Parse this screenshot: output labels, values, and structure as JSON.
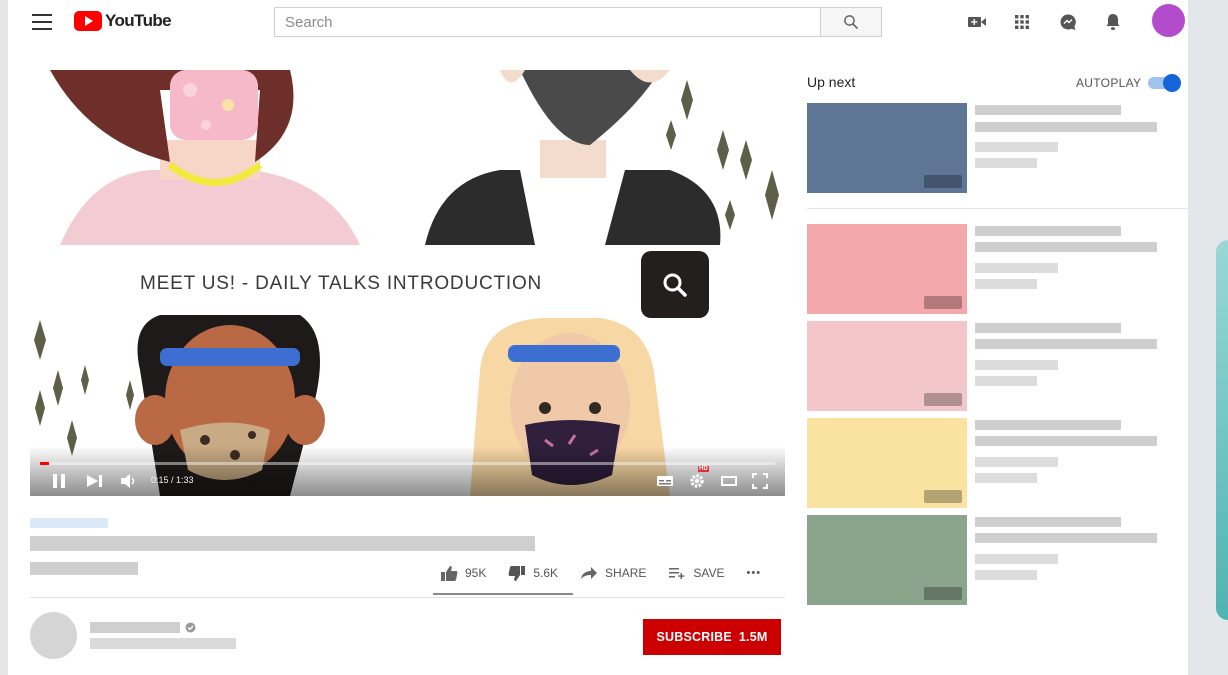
{
  "header": {
    "logo_text": "YouTube",
    "search_placeholder": "Search"
  },
  "player": {
    "video_title": "MEET US! - DAILY TALKS INTRODUCTION",
    "time_display": "0:15 / 1:33",
    "progress_fraction": 0.012,
    "hd_badge": "HD"
  },
  "actions": {
    "like_count": "95K",
    "dislike_count": "5.6K",
    "share_label": "SHARE",
    "save_label": "SAVE",
    "more_label": "•••"
  },
  "channel": {
    "subscribe_label": "SUBSCRIBE",
    "subscriber_count": "1.5M"
  },
  "sidebar": {
    "up_next_label": "Up next",
    "autoplay_label": "AUTOPLAY",
    "autoplay_on": true,
    "thumbnail_colors": [
      "#5e7596",
      "#f5a8ab",
      "#f3c6c9",
      "#fae3a0",
      "#8aa58b"
    ]
  },
  "colors": {
    "brand_red": "#ff0000",
    "subscribe_red": "#cc0000",
    "accent_blue": "#1565d8",
    "avatar_purple": "#b24ccc"
  }
}
